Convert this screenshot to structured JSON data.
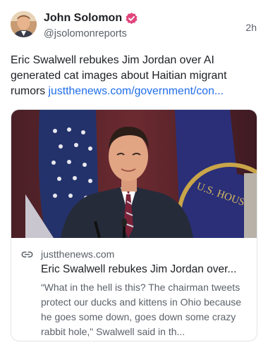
{
  "post": {
    "author_name": "John Solomon",
    "handle": "@jsolomonreports",
    "timestamp": "2h",
    "verified_icon": "verified-badge-icon",
    "text": "Eric Swalwell rebukes Jim Jordan over AI generated cat images about Haitian migrant rumors ",
    "link_text": "justthenews.com/government/con...",
    "accent_color": "#1f6dea",
    "verified_color": "#e0457b"
  },
  "link_card": {
    "icon": "link-icon",
    "domain": "justthenews.com",
    "title": "Eric Swalwell rebukes Jim Jordan over...",
    "description": "“What in the hell is this? The chairman tweets protect our ducks and kittens in Ohio because he goes some down, goes down some crazy rabbit hole,\" Swalwell said in th..."
  }
}
